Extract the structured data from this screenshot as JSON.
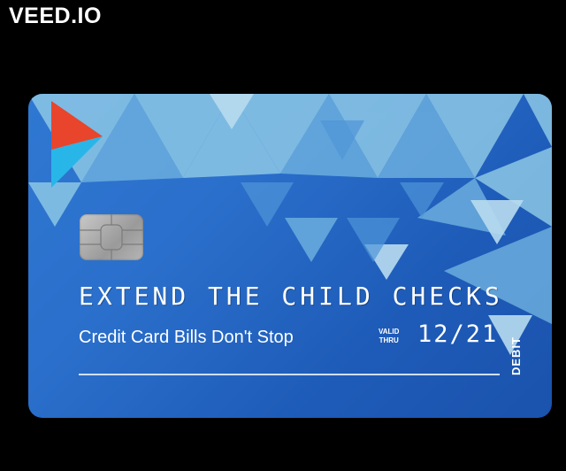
{
  "watermark": "VEED.IO",
  "card": {
    "headline": "EXTEND THE CHILD CHECKS",
    "subline": "Credit Card Bills Don't Stop",
    "valid_label_top": "VALID",
    "valid_label_bottom": "THRU",
    "expiry": "12/21",
    "type": "DEBIT"
  },
  "colors": {
    "background": "#000000",
    "card_blue": "#2a6fcb",
    "logo_red": "#e8452c",
    "logo_cyan": "#28b6e8"
  }
}
